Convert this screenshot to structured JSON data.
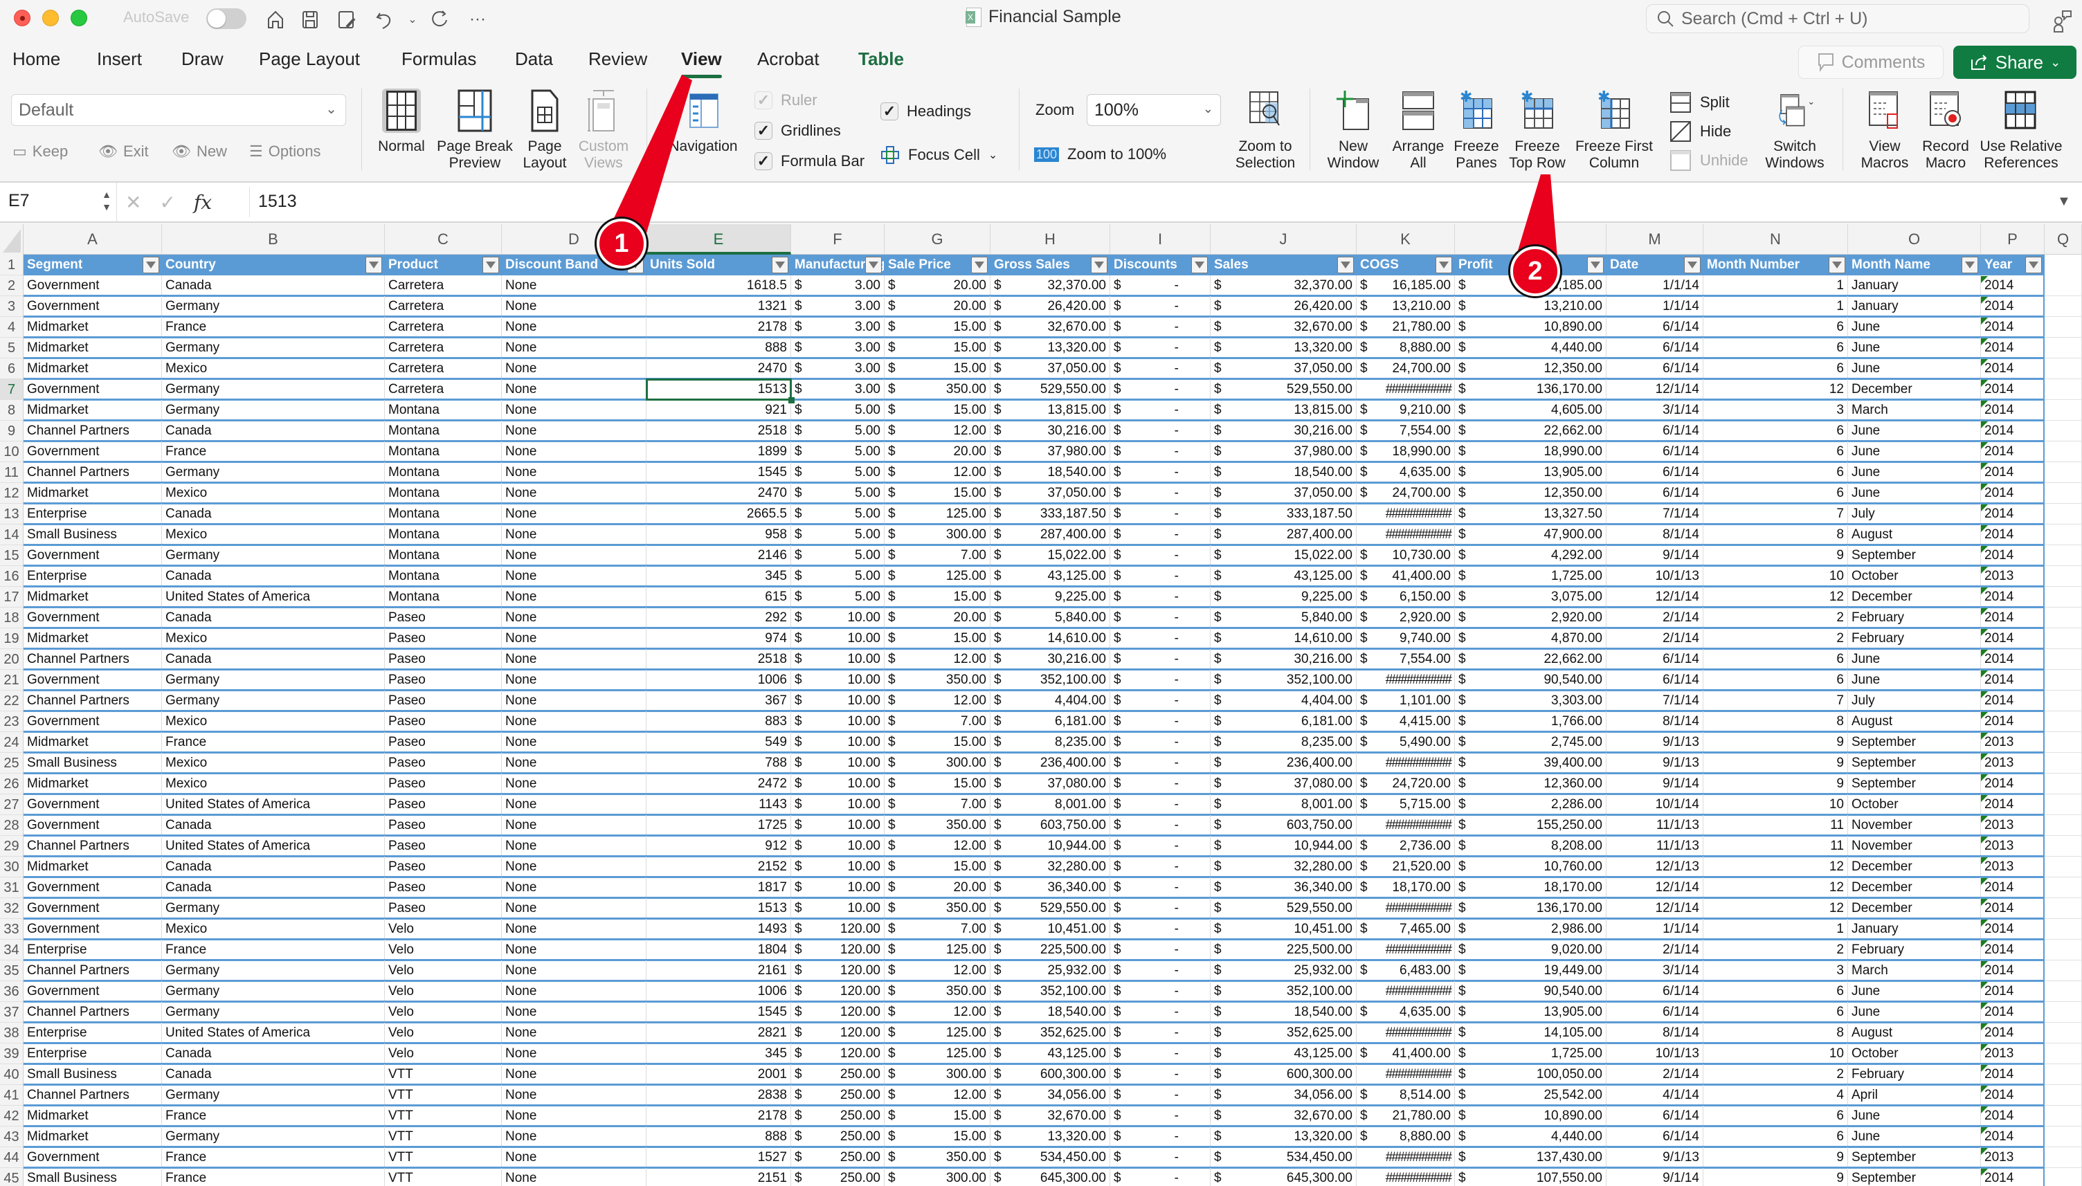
{
  "window": {
    "autosave_label": "AutoSave",
    "title": "Financial Sample",
    "search_placeholder": "Search (Cmd + Ctrl + U)"
  },
  "menu_tabs": [
    {
      "label": "Home",
      "active": false
    },
    {
      "label": "Insert",
      "active": false
    },
    {
      "label": "Draw",
      "active": false
    },
    {
      "label": "Page Layout",
      "active": false
    },
    {
      "label": "Formulas",
      "active": false
    },
    {
      "label": "Data",
      "active": false
    },
    {
      "label": "Review",
      "active": false
    },
    {
      "label": "View",
      "active": true
    },
    {
      "label": "Acrobat",
      "active": false
    },
    {
      "label": "Table",
      "active": false,
      "contextual": true
    }
  ],
  "header_buttons": {
    "comments": "Comments",
    "share": "Share"
  },
  "ribbon": {
    "sheet_view": {
      "selected": "Default",
      "keep": "Keep",
      "exit": "Exit",
      "new": "New",
      "options": "Options"
    },
    "workbook_views": [
      {
        "label_1": "Normal",
        "label_2": "",
        "active": true,
        "disabled": false
      },
      {
        "label_1": "Page Break",
        "label_2": "Preview",
        "active": false,
        "disabled": false
      },
      {
        "label_1": "Page",
        "label_2": "Layout",
        "active": false,
        "disabled": false
      },
      {
        "label_1": "Custom",
        "label_2": "Views",
        "active": false,
        "disabled": true
      }
    ],
    "navigation": "Navigation",
    "show": {
      "ruler": {
        "label": "Ruler",
        "checked": true,
        "disabled": true
      },
      "gridlines": {
        "label": "Gridlines",
        "checked": true
      },
      "formula_bar": {
        "label": "Formula Bar",
        "checked": true
      },
      "headings": {
        "label": "Headings",
        "checked": true
      },
      "focus_cell": "Focus Cell"
    },
    "zoom": {
      "label": "Zoom",
      "value": "100%",
      "zoom_to_100_badge": "100",
      "zoom_to_100": "Zoom to 100%",
      "zoom_to_selection_1": "Zoom to",
      "zoom_to_selection_2": "Selection"
    },
    "window": {
      "new_window_1": "New",
      "new_window_2": "Window",
      "arrange_all_1": "Arrange",
      "arrange_all_2": "All",
      "freeze_panes_1": "Freeze",
      "freeze_panes_2": "Panes",
      "freeze_top_row_1": "Freeze",
      "freeze_top_row_2": "Top Row",
      "freeze_first_col_1": "Freeze First",
      "freeze_first_col_2": "Column",
      "split": "Split",
      "hide": "Hide",
      "unhide": "Unhide",
      "switch_windows_1": "Switch",
      "switch_windows_2": "Windows"
    },
    "macros": {
      "view_macros_1": "View",
      "view_macros_2": "Macros",
      "record_macro_1": "Record",
      "record_macro_2": "Macro",
      "relative_refs_1": "Use Relative",
      "relative_refs_2": "References"
    }
  },
  "formula_bar": {
    "name_box": "E7",
    "formula": "1513"
  },
  "sheet": {
    "columns": [
      "A",
      "B",
      "C",
      "D",
      "E",
      "F",
      "G",
      "H",
      "I",
      "J",
      "K",
      "L",
      "M",
      "N",
      "O",
      "P",
      "Q"
    ],
    "selected_column": "E",
    "selected_row": 7,
    "headers": [
      "Segment",
      "Country",
      "Product",
      "Discount Band",
      "Units Sold",
      "Manufacturing",
      "Sale Price",
      "Gross Sales",
      "Discounts",
      "Sales",
      "COGS",
      "Profit",
      "Date",
      "Month Number",
      "Month Name",
      "Year"
    ],
    "rows": [
      [
        "Government",
        "Canada",
        "Carretera",
        "None",
        "1618.5",
        "3.00",
        "20.00",
        "32,370.00",
        "-",
        "32,370.00",
        "$ 16,185.00",
        "16,185.00",
        "1/1/14",
        "1",
        "January",
        "2014"
      ],
      [
        "Government",
        "Germany",
        "Carretera",
        "None",
        "1321",
        "3.00",
        "20.00",
        "26,420.00",
        "-",
        "26,420.00",
        "$ 13,210.00",
        "13,210.00",
        "1/1/14",
        "1",
        "January",
        "2014"
      ],
      [
        "Midmarket",
        "France",
        "Carretera",
        "None",
        "2178",
        "3.00",
        "15.00",
        "32,670.00",
        "-",
        "32,670.00",
        "$ 21,780.00",
        "10,890.00",
        "6/1/14",
        "6",
        "June",
        "2014"
      ],
      [
        "Midmarket",
        "Germany",
        "Carretera",
        "None",
        "888",
        "3.00",
        "15.00",
        "13,320.00",
        "-",
        "13,320.00",
        "$   8,880.00",
        "4,440.00",
        "6/1/14",
        "6",
        "June",
        "2014"
      ],
      [
        "Midmarket",
        "Mexico",
        "Carretera",
        "None",
        "2470",
        "3.00",
        "15.00",
        "37,050.00",
        "-",
        "37,050.00",
        "$ 24,700.00",
        "12,350.00",
        "6/1/14",
        "6",
        "June",
        "2014"
      ],
      [
        "Government",
        "Germany",
        "Carretera",
        "None",
        "1513",
        "3.00",
        "350.00",
        "529,550.00",
        "-",
        "529,550.00",
        "###########",
        "136,170.00",
        "12/1/14",
        "12",
        "December",
        "2014"
      ],
      [
        "Midmarket",
        "Germany",
        "Montana",
        "None",
        "921",
        "5.00",
        "15.00",
        "13,815.00",
        "-",
        "13,815.00",
        "$   9,210.00",
        "4,605.00",
        "3/1/14",
        "3",
        "March",
        "2014"
      ],
      [
        "Channel Partners",
        "Canada",
        "Montana",
        "None",
        "2518",
        "5.00",
        "12.00",
        "30,216.00",
        "-",
        "30,216.00",
        "$   7,554.00",
        "22,662.00",
        "6/1/14",
        "6",
        "June",
        "2014"
      ],
      [
        "Government",
        "France",
        "Montana",
        "None",
        "1899",
        "5.00",
        "20.00",
        "37,980.00",
        "-",
        "37,980.00",
        "$ 18,990.00",
        "18,990.00",
        "6/1/14",
        "6",
        "June",
        "2014"
      ],
      [
        "Channel Partners",
        "Germany",
        "Montana",
        "None",
        "1545",
        "5.00",
        "12.00",
        "18,540.00",
        "-",
        "18,540.00",
        "$   4,635.00",
        "13,905.00",
        "6/1/14",
        "6",
        "June",
        "2014"
      ],
      [
        "Midmarket",
        "Mexico",
        "Montana",
        "None",
        "2470",
        "5.00",
        "15.00",
        "37,050.00",
        "-",
        "37,050.00",
        "$ 24,700.00",
        "12,350.00",
        "6/1/14",
        "6",
        "June",
        "2014"
      ],
      [
        "Enterprise",
        "Canada",
        "Montana",
        "None",
        "2665.5",
        "5.00",
        "125.00",
        "333,187.50",
        "-",
        "333,187.50",
        "###########",
        "13,327.50",
        "7/1/14",
        "7",
        "July",
        "2014"
      ],
      [
        "Small Business",
        "Mexico",
        "Montana",
        "None",
        "958",
        "5.00",
        "300.00",
        "287,400.00",
        "-",
        "287,400.00",
        "###########",
        "47,900.00",
        "8/1/14",
        "8",
        "August",
        "2014"
      ],
      [
        "Government",
        "Germany",
        "Montana",
        "None",
        "2146",
        "5.00",
        "7.00",
        "15,022.00",
        "-",
        "15,022.00",
        "$ 10,730.00",
        "4,292.00",
        "9/1/14",
        "9",
        "September",
        "2014"
      ],
      [
        "Enterprise",
        "Canada",
        "Montana",
        "None",
        "345",
        "5.00",
        "125.00",
        "43,125.00",
        "-",
        "43,125.00",
        "$ 41,400.00",
        "1,725.00",
        "10/1/13",
        "10",
        "October",
        "2013"
      ],
      [
        "Midmarket",
        "United States of America",
        "Montana",
        "None",
        "615",
        "5.00",
        "15.00",
        "9,225.00",
        "-",
        "9,225.00",
        "$   6,150.00",
        "3,075.00",
        "12/1/14",
        "12",
        "December",
        "2014"
      ],
      [
        "Government",
        "Canada",
        "Paseo",
        "None",
        "292",
        "10.00",
        "20.00",
        "5,840.00",
        "-",
        "5,840.00",
        "$   2,920.00",
        "2,920.00",
        "2/1/14",
        "2",
        "February",
        "2014"
      ],
      [
        "Midmarket",
        "Mexico",
        "Paseo",
        "None",
        "974",
        "10.00",
        "15.00",
        "14,610.00",
        "-",
        "14,610.00",
        "$   9,740.00",
        "4,870.00",
        "2/1/14",
        "2",
        "February",
        "2014"
      ],
      [
        "Channel Partners",
        "Canada",
        "Paseo",
        "None",
        "2518",
        "10.00",
        "12.00",
        "30,216.00",
        "-",
        "30,216.00",
        "$   7,554.00",
        "22,662.00",
        "6/1/14",
        "6",
        "June",
        "2014"
      ],
      [
        "Government",
        "Germany",
        "Paseo",
        "None",
        "1006",
        "10.00",
        "350.00",
        "352,100.00",
        "-",
        "352,100.00",
        "###########",
        "90,540.00",
        "6/1/14",
        "6",
        "June",
        "2014"
      ],
      [
        "Channel Partners",
        "Germany",
        "Paseo",
        "None",
        "367",
        "10.00",
        "12.00",
        "4,404.00",
        "-",
        "4,404.00",
        "$   1,101.00",
        "3,303.00",
        "7/1/14",
        "7",
        "July",
        "2014"
      ],
      [
        "Government",
        "Mexico",
        "Paseo",
        "None",
        "883",
        "10.00",
        "7.00",
        "6,181.00",
        "-",
        "6,181.00",
        "$   4,415.00",
        "1,766.00",
        "8/1/14",
        "8",
        "August",
        "2014"
      ],
      [
        "Midmarket",
        "France",
        "Paseo",
        "None",
        "549",
        "10.00",
        "15.00",
        "8,235.00",
        "-",
        "8,235.00",
        "$   5,490.00",
        "2,745.00",
        "9/1/13",
        "9",
        "September",
        "2013"
      ],
      [
        "Small Business",
        "Mexico",
        "Paseo",
        "None",
        "788",
        "10.00",
        "300.00",
        "236,400.00",
        "-",
        "236,400.00",
        "###########",
        "39,400.00",
        "9/1/13",
        "9",
        "September",
        "2013"
      ],
      [
        "Midmarket",
        "Mexico",
        "Paseo",
        "None",
        "2472",
        "10.00",
        "15.00",
        "37,080.00",
        "-",
        "37,080.00",
        "$ 24,720.00",
        "12,360.00",
        "9/1/14",
        "9",
        "September",
        "2014"
      ],
      [
        "Government",
        "United States of America",
        "Paseo",
        "None",
        "1143",
        "10.00",
        "7.00",
        "8,001.00",
        "-",
        "8,001.00",
        "$   5,715.00",
        "2,286.00",
        "10/1/14",
        "10",
        "October",
        "2014"
      ],
      [
        "Government",
        "Canada",
        "Paseo",
        "None",
        "1725",
        "10.00",
        "350.00",
        "603,750.00",
        "-",
        "603,750.00",
        "###########",
        "155,250.00",
        "11/1/13",
        "11",
        "November",
        "2013"
      ],
      [
        "Channel Partners",
        "United States of America",
        "Paseo",
        "None",
        "912",
        "10.00",
        "12.00",
        "10,944.00",
        "-",
        "10,944.00",
        "$   2,736.00",
        "8,208.00",
        "11/1/13",
        "11",
        "November",
        "2013"
      ],
      [
        "Midmarket",
        "Canada",
        "Paseo",
        "None",
        "2152",
        "10.00",
        "15.00",
        "32,280.00",
        "-",
        "32,280.00",
        "$ 21,520.00",
        "10,760.00",
        "12/1/13",
        "12",
        "December",
        "2013"
      ],
      [
        "Government",
        "Canada",
        "Paseo",
        "None",
        "1817",
        "10.00",
        "20.00",
        "36,340.00",
        "-",
        "36,340.00",
        "$ 18,170.00",
        "18,170.00",
        "12/1/14",
        "12",
        "December",
        "2014"
      ],
      [
        "Government",
        "Germany",
        "Paseo",
        "None",
        "1513",
        "10.00",
        "350.00",
        "529,550.00",
        "-",
        "529,550.00",
        "###########",
        "136,170.00",
        "12/1/14",
        "12",
        "December",
        "2014"
      ],
      [
        "Government",
        "Mexico",
        "Velo",
        "None",
        "1493",
        "120.00",
        "7.00",
        "10,451.00",
        "-",
        "10,451.00",
        "$   7,465.00",
        "2,986.00",
        "1/1/14",
        "1",
        "January",
        "2014"
      ],
      [
        "Enterprise",
        "France",
        "Velo",
        "None",
        "1804",
        "120.00",
        "125.00",
        "225,500.00",
        "-",
        "225,500.00",
        "###########",
        "9,020.00",
        "2/1/14",
        "2",
        "February",
        "2014"
      ],
      [
        "Channel Partners",
        "Germany",
        "Velo",
        "None",
        "2161",
        "120.00",
        "12.00",
        "25,932.00",
        "-",
        "25,932.00",
        "$   6,483.00",
        "19,449.00",
        "3/1/14",
        "3",
        "March",
        "2014"
      ],
      [
        "Government",
        "Germany",
        "Velo",
        "None",
        "1006",
        "120.00",
        "350.00",
        "352,100.00",
        "-",
        "352,100.00",
        "###########",
        "90,540.00",
        "6/1/14",
        "6",
        "June",
        "2014"
      ],
      [
        "Channel Partners",
        "Germany",
        "Velo",
        "None",
        "1545",
        "120.00",
        "12.00",
        "18,540.00",
        "-",
        "18,540.00",
        "$   4,635.00",
        "13,905.00",
        "6/1/14",
        "6",
        "June",
        "2014"
      ],
      [
        "Enterprise",
        "United States of America",
        "Velo",
        "None",
        "2821",
        "120.00",
        "125.00",
        "352,625.00",
        "-",
        "352,625.00",
        "###########",
        "14,105.00",
        "8/1/14",
        "8",
        "August",
        "2014"
      ],
      [
        "Enterprise",
        "Canada",
        "Velo",
        "None",
        "345",
        "120.00",
        "125.00",
        "43,125.00",
        "-",
        "43,125.00",
        "$ 41,400.00",
        "1,725.00",
        "10/1/13",
        "10",
        "October",
        "2013"
      ],
      [
        "Small Business",
        "Canada",
        "VTT",
        "None",
        "2001",
        "250.00",
        "300.00",
        "600,300.00",
        "-",
        "600,300.00",
        "###########",
        "100,050.00",
        "2/1/14",
        "2",
        "February",
        "2014"
      ],
      [
        "Channel Partners",
        "Germany",
        "VTT",
        "None",
        "2838",
        "250.00",
        "12.00",
        "34,056.00",
        "-",
        "34,056.00",
        "$   8,514.00",
        "25,542.00",
        "4/1/14",
        "4",
        "April",
        "2014"
      ],
      [
        "Midmarket",
        "France",
        "VTT",
        "None",
        "2178",
        "250.00",
        "15.00",
        "32,670.00",
        "-",
        "32,670.00",
        "$ 21,780.00",
        "10,890.00",
        "6/1/14",
        "6",
        "June",
        "2014"
      ],
      [
        "Midmarket",
        "Germany",
        "VTT",
        "None",
        "888",
        "250.00",
        "15.00",
        "13,320.00",
        "-",
        "13,320.00",
        "$   8,880.00",
        "4,440.00",
        "6/1/14",
        "6",
        "June",
        "2014"
      ],
      [
        "Government",
        "France",
        "VTT",
        "None",
        "1527",
        "250.00",
        "350.00",
        "534,450.00",
        "-",
        "534,450.00",
        "###########",
        "137,430.00",
        "9/1/13",
        "9",
        "September",
        "2013"
      ],
      [
        "Small Business",
        "France",
        "VTT",
        "None",
        "2151",
        "250.00",
        "300.00",
        "645,300.00",
        "-",
        "645,300.00",
        "###########",
        "107,550.00",
        "9/1/14",
        "9",
        "September",
        "2014"
      ]
    ],
    "currency_symbol": "$"
  },
  "annotations": [
    {
      "number": "1",
      "points_to": "View tab"
    },
    {
      "number": "2",
      "points_to": "Freeze Top Row"
    }
  ]
}
